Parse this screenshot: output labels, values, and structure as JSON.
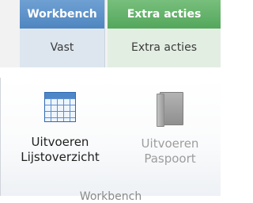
{
  "tabs": [
    {
      "header": "Workbench",
      "label": "Vast",
      "color": "#4f86c0"
    },
    {
      "header": "Extra acties",
      "label": "Extra acties",
      "color": "#54a75c"
    }
  ],
  "ribbon": {
    "buttons": [
      {
        "line1": "Uitvoeren",
        "line2": "Lijstoverzicht",
        "icon": "table-grid-icon",
        "enabled": true
      },
      {
        "line1": "Uitvoeren",
        "line2": "Paspoort",
        "icon": "book-icon",
        "enabled": false
      }
    ],
    "group_caption": "Workbench"
  }
}
